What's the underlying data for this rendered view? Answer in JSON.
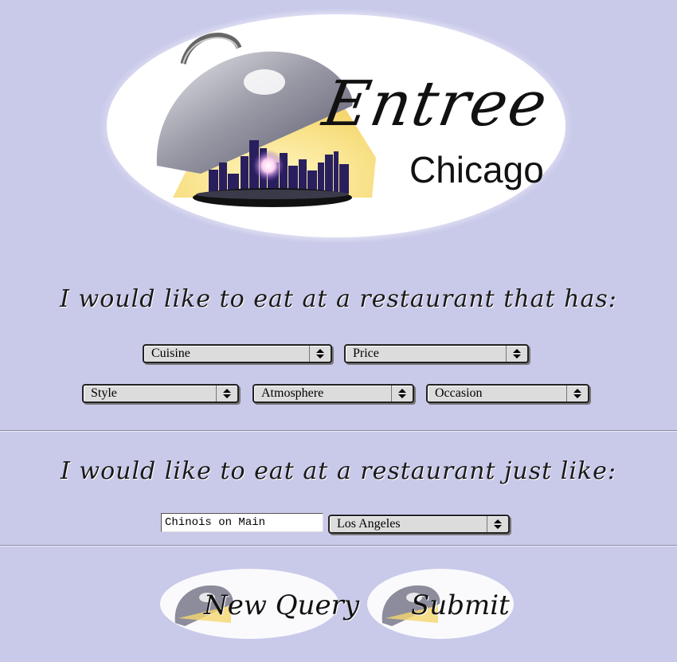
{
  "logo": {
    "title_script": "Entree",
    "city": "Chicago"
  },
  "prompts": {
    "features": "I would like to eat at a restaurant that has:",
    "similar": "I would like to eat at a restaurant just like:"
  },
  "selects": {
    "cuisine": "Cuisine",
    "price": "Price",
    "style": "Style",
    "atmosphere": "Atmosphere",
    "occasion": "Occasion",
    "city": "Los Angeles"
  },
  "restaurant_input": {
    "value": "Chinois on Main"
  },
  "buttons": {
    "new_query": "New Query",
    "submit": "Submit"
  },
  "colors": {
    "background": "#c9c9ea",
    "logo_oval": "#ffffff",
    "cloche": "#9a9aa6",
    "glow": "#f7e07a",
    "skyline": "#2a1f5e"
  }
}
